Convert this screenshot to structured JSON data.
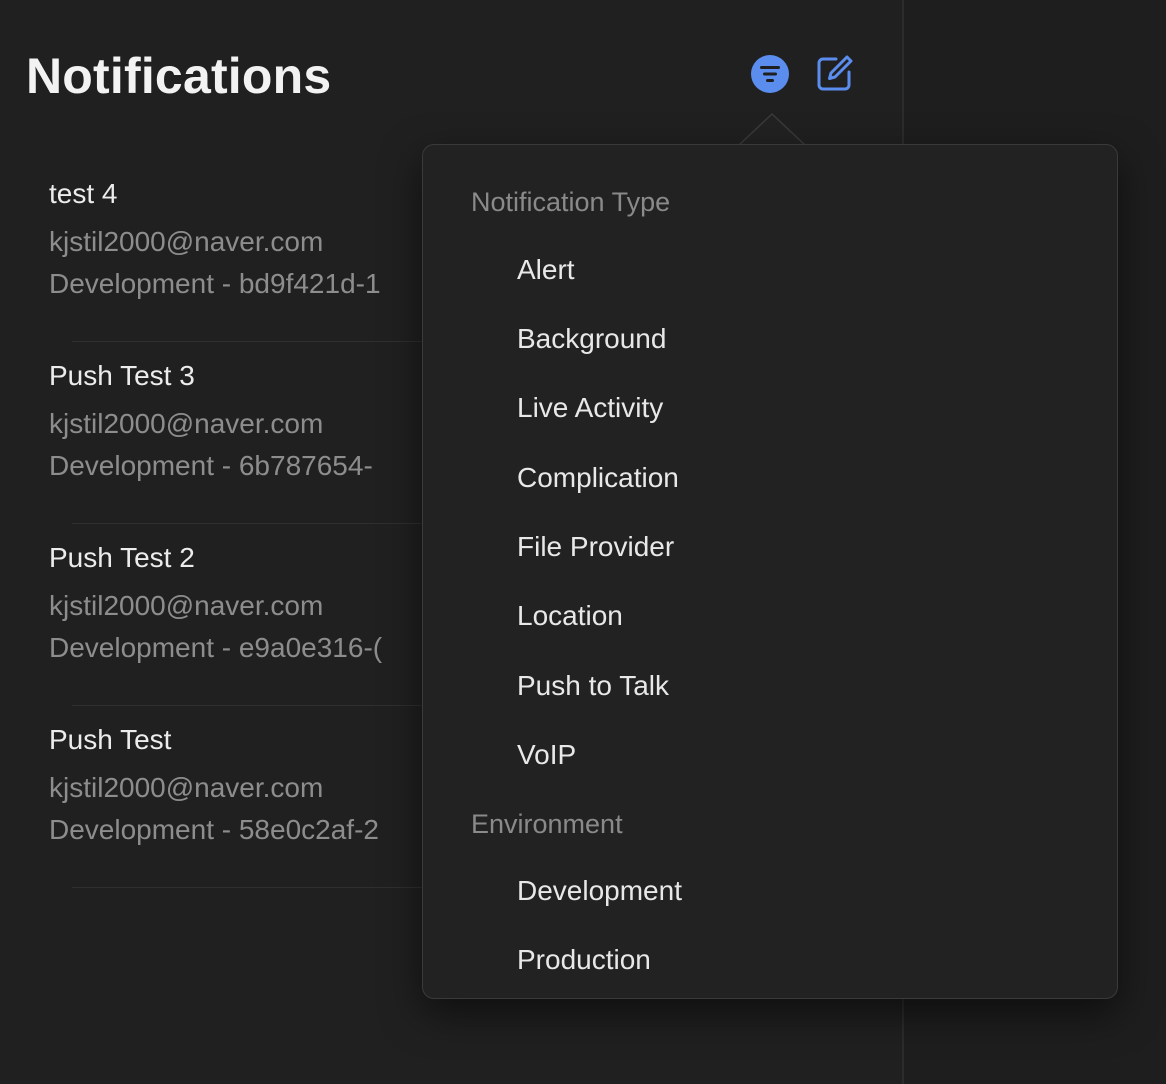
{
  "header": {
    "title": "Notifications",
    "filter_icon": "filter-circle-icon",
    "compose_icon": "compose-icon",
    "accent": "#5b8def"
  },
  "notifications": [
    {
      "title": "test 4",
      "email": "kjstil2000@naver.com",
      "meta": "Development - bd9f421d-1"
    },
    {
      "title": "Push Test 3",
      "email": "kjstil2000@naver.com",
      "meta": "Development - 6b787654-"
    },
    {
      "title": "Push Test 2",
      "email": "kjstil2000@naver.com",
      "meta": "Development - e9a0e316-("
    },
    {
      "title": "Push Test",
      "email": "kjstil2000@naver.com",
      "meta": "Development - 58e0c2af-2"
    }
  ],
  "filter_menu": {
    "type_header": "Notification Type",
    "types": [
      "Alert",
      "Background",
      "Live Activity",
      "Complication",
      "File Provider",
      "Location",
      "Push to Talk",
      "VoIP"
    ],
    "environment_header": "Environment",
    "environments": [
      "Development",
      "Production"
    ]
  }
}
